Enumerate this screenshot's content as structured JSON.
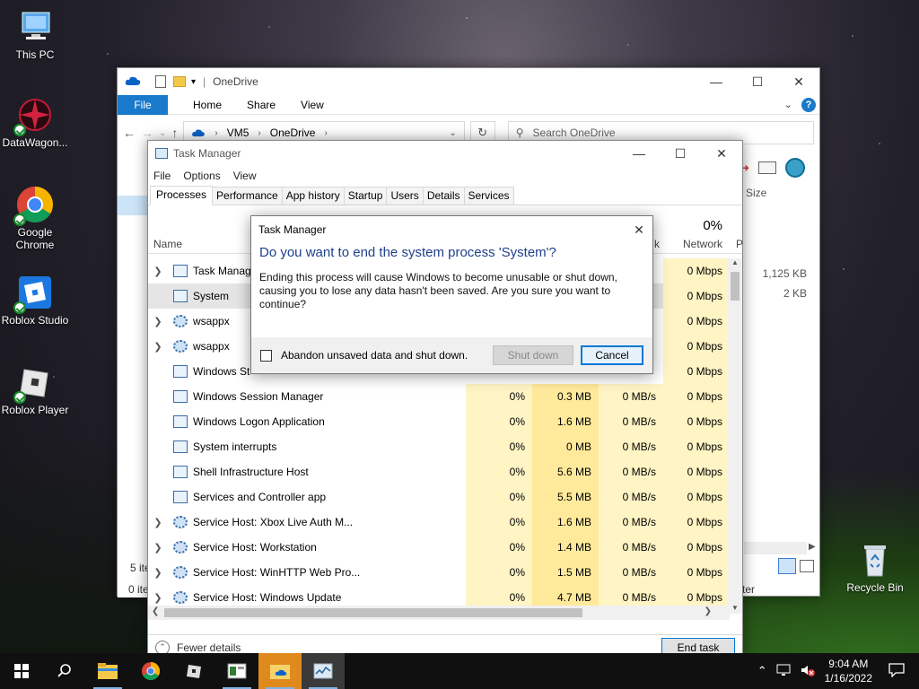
{
  "desktop": {
    "icons": [
      {
        "label": "This PC"
      },
      {
        "label": "DataWagon..."
      },
      {
        "label": "Google Chrome"
      },
      {
        "label": "Roblox Studio"
      },
      {
        "label": "Roblox Player"
      },
      {
        "label": "Recycle Bin"
      }
    ]
  },
  "explorer": {
    "title": "OneDrive",
    "tabs": [
      "File",
      "Home",
      "Share",
      "View"
    ],
    "path": [
      "VM5",
      "OneDrive"
    ],
    "search_placeholder": "Search OneDrive",
    "column_size": "Size",
    "sizes": [
      "1,125 KB",
      "2 KB"
    ],
    "status_items": "5 ite",
    "status_selected": "0 item",
    "status_right": "ter"
  },
  "taskmgr": {
    "title": "Task Manager",
    "menu": [
      "File",
      "Options",
      "View"
    ],
    "tabs": [
      "Processes",
      "Performance",
      "App history",
      "Startup",
      "Users",
      "Details",
      "Services"
    ],
    "col_name": "Name",
    "col_network_pct": "0%",
    "col_network": "Network",
    "col_p": "P",
    "col_k": "k",
    "processes": [
      {
        "name": "Task Manager",
        "expandable": true,
        "cpu": "",
        "mem": "",
        "disk": "",
        "net": "0 Mbps"
      },
      {
        "name": "System",
        "expandable": false,
        "cpu": "",
        "mem": "",
        "disk": "",
        "net": "0 Mbps"
      },
      {
        "name": "wsappx",
        "expandable": true,
        "cpu": "",
        "mem": "",
        "disk": "",
        "net": "0 Mbps"
      },
      {
        "name": "wsappx",
        "expandable": true,
        "cpu": "",
        "mem": "",
        "disk": "",
        "net": "0 Mbps"
      },
      {
        "name": "Windows St",
        "expandable": false,
        "cpu": "",
        "mem": "",
        "disk": "",
        "net": "0 Mbps"
      },
      {
        "name": "Windows Session Manager",
        "expandable": false,
        "cpu": "0%",
        "mem": "0.3 MB",
        "disk": "0 MB/s",
        "net": "0 Mbps"
      },
      {
        "name": "Windows Logon Application",
        "expandable": false,
        "cpu": "0%",
        "mem": "1.6 MB",
        "disk": "0 MB/s",
        "net": "0 Mbps"
      },
      {
        "name": "System interrupts",
        "expandable": false,
        "cpu": "0%",
        "mem": "0 MB",
        "disk": "0 MB/s",
        "net": "0 Mbps"
      },
      {
        "name": "Shell Infrastructure Host",
        "expandable": false,
        "cpu": "0%",
        "mem": "5.6 MB",
        "disk": "0 MB/s",
        "net": "0 Mbps"
      },
      {
        "name": "Services and Controller app",
        "expandable": false,
        "cpu": "0%",
        "mem": "5.5 MB",
        "disk": "0 MB/s",
        "net": "0 Mbps"
      },
      {
        "name": "Service Host: Xbox Live Auth M...",
        "expandable": true,
        "cpu": "0%",
        "mem": "1.6 MB",
        "disk": "0 MB/s",
        "net": "0 Mbps"
      },
      {
        "name": "Service Host: Workstation",
        "expandable": true,
        "cpu": "0%",
        "mem": "1.4 MB",
        "disk": "0 MB/s",
        "net": "0 Mbps"
      },
      {
        "name": "Service Host: WinHTTP Web Pro...",
        "expandable": true,
        "cpu": "0%",
        "mem": "1.5 MB",
        "disk": "0 MB/s",
        "net": "0 Mbps"
      },
      {
        "name": "Service Host: Windows Update",
        "expandable": true,
        "cpu": "0%",
        "mem": "4.7 MB",
        "disk": "0 MB/s",
        "net": "0 Mbps"
      }
    ],
    "fewer_details": "Fewer details",
    "end_task": "End task"
  },
  "dialog": {
    "title": "Task Manager",
    "heading": "Do you want to end the system process 'System'?",
    "body": "Ending this process will cause Windows to become unusable or shut down, causing you to lose any data hasn't been saved. Are you sure you want to continue?",
    "checkbox_label": "Abandon unsaved data and shut down.",
    "shutdown_label": "Shut down",
    "cancel_label": "Cancel"
  },
  "taskbar": {
    "time": "9:04 AM",
    "date": "1/16/2022"
  },
  "colors": {
    "accent": "#0078d7",
    "heading_blue": "#1e3f8a",
    "cpu_heat": "#fff4c4",
    "mem_heat": "#ffe99a"
  }
}
